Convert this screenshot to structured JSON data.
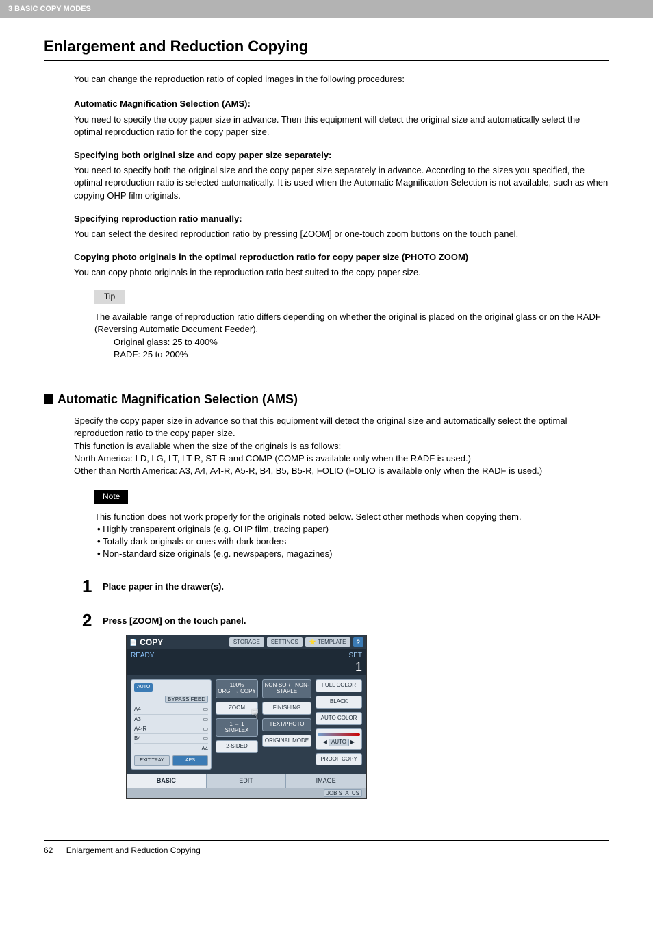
{
  "header": {
    "chapter": "3 BASIC COPY MODES"
  },
  "title": "Enlargement and Reduction Copying",
  "intro": "You can change the reproduction ratio of copied images in the following procedures:",
  "sections": [
    {
      "heading": "Automatic Magnification Selection (AMS):",
      "body": "You need to specify the copy paper size in advance. Then this equipment will detect the original size and automatically select the optimal reproduction ratio for the copy paper size."
    },
    {
      "heading": "Specifying both original size and copy paper size separately:",
      "body": "You need to specify both the original size and the copy paper size separately in advance. According to the sizes you specified, the optimal reproduction ratio is selected automatically. It is used when the Automatic Magnification Selection is not available, such as when copying OHP film originals."
    },
    {
      "heading": "Specifying reproduction ratio manually:",
      "body": "You can select the desired reproduction ratio by pressing [ZOOM] or one-touch zoom buttons on the touch panel."
    },
    {
      "heading": "Copying photo originals in the optimal reproduction ratio for copy paper size (PHOTO ZOOM)",
      "body": "You can copy photo originals in the reproduction ratio best suited to the copy paper size."
    }
  ],
  "tip": {
    "label": "Tip",
    "line1": "The available range of reproduction ratio differs depending on whether the original is placed on the original glass or on the RADF (Reversing Automatic Document Feeder).",
    "line2": "Original glass: 25 to 400%",
    "line3": "RADF: 25 to 200%"
  },
  "h2": "Automatic Magnification Selection (AMS)",
  "ams": {
    "p1": "Specify the copy paper size in advance so that this equipment will detect the original size and automatically select the optimal reproduction ratio to the copy paper size.",
    "p2": "This function is available when the size of the originals is as follows:",
    "p3": "North America: LD, LG, LT, LT-R, ST-R and COMP (COMP is available only when the RADF is used.)",
    "p4": "Other than North America: A3, A4, A4-R, A5-R, B4, B5, B5-R, FOLIO (FOLIO is available only when the RADF is used.)"
  },
  "note": {
    "label": "Note",
    "intro": "This function does not work properly for the originals noted below. Select other methods when copying them.",
    "items": [
      "Highly transparent originals (e.g. OHP film, tracing paper)",
      "Totally dark originals or ones with dark borders",
      "Non-standard size originals (e.g. newspapers, magazines)"
    ]
  },
  "steps": [
    {
      "num": "1",
      "text": "Place paper in the drawer(s)."
    },
    {
      "num": "2",
      "text": "Press [ZOOM] on the touch panel."
    }
  ],
  "panel": {
    "copy": "COPY",
    "tabs": {
      "storage": "STORAGE",
      "settings": "SETTINGS",
      "template": "TEMPLATE",
      "help": "?"
    },
    "ready": "READY",
    "set": "SET",
    "setcount": "1",
    "auto": "AUTO",
    "bypass": "BYPASS FEED",
    "papers": [
      "A4",
      "A3",
      "A4-R",
      "B4"
    ],
    "papers_side": "A4",
    "exit_tray": "EXIT TRAY",
    "aps": "APS",
    "ratio": "100%",
    "org_copy": "ORG. → COPY",
    "zoom": "ZOOM",
    "simplex_t": "1 → 1",
    "simplex_b": "SIMPLEX",
    "twosided": "2-SIDED",
    "nonsort": "NON-SORT NON-STAPLE",
    "finishing": "FINISHING",
    "textphoto": "TEXT/PHOTO",
    "original_mode": "ORIGINAL MODE",
    "full_color": "FULL COLOR",
    "black": "BLACK",
    "auto_color": "AUTO COLOR",
    "auto_small": "AUTO",
    "proof": "PROOF COPY",
    "bottom": {
      "basic": "BASIC",
      "edit": "EDIT",
      "image": "IMAGE"
    },
    "job_status": "JOB STATUS"
  },
  "footer": {
    "page": "62",
    "title": "Enlargement and Reduction Copying"
  }
}
